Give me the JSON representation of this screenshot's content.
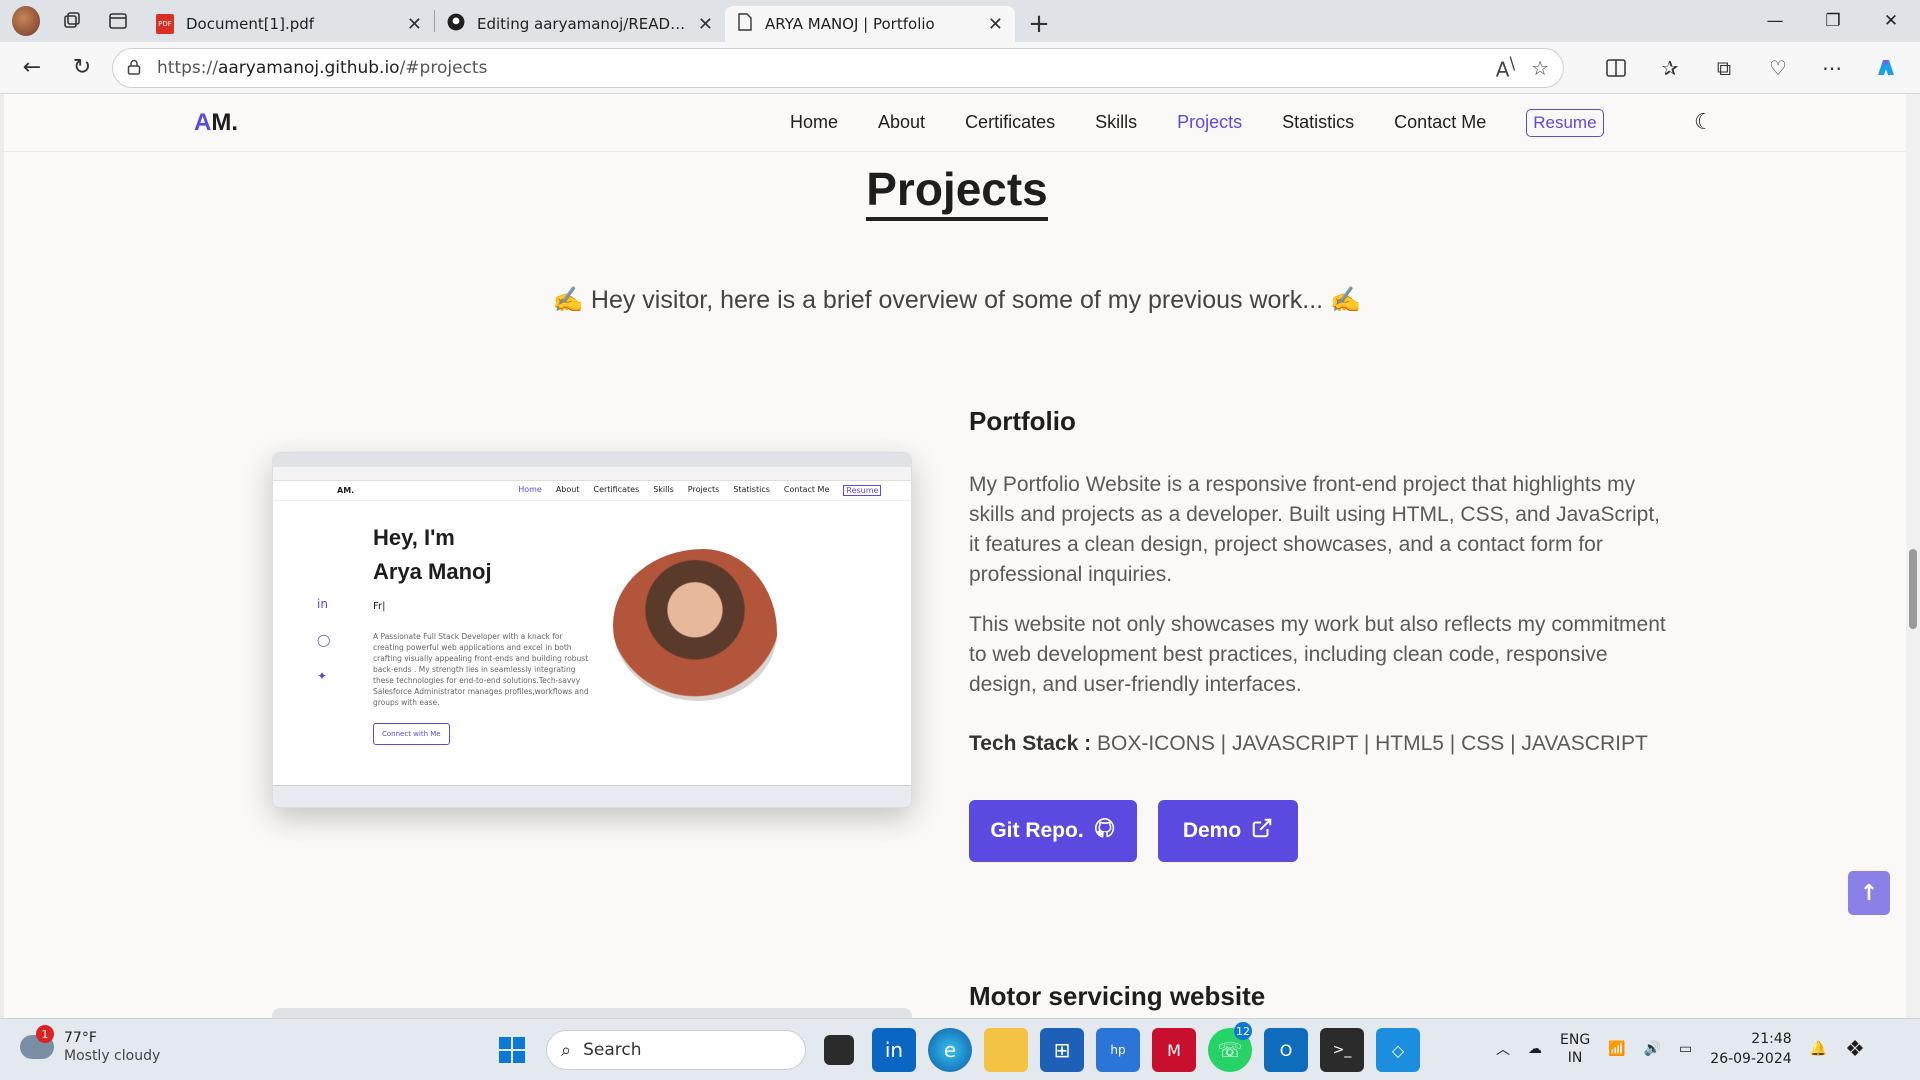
{
  "browser": {
    "tabs": [
      {
        "title": "Document[1].pdf",
        "icon": "pdf-icon"
      },
      {
        "title": "Editing aaryamanoj/README.md at",
        "icon": "github-icon"
      },
      {
        "title": "ARYA MANOJ | Portfolio",
        "icon": "page-icon",
        "active": true
      }
    ],
    "url_prefix": "https://",
    "url_host": "aaryamanoj.github.io",
    "url_path": "/#projects"
  },
  "site": {
    "logo_a": "A",
    "logo_rest": "M.",
    "nav": [
      "Home",
      "About",
      "Certificates",
      "Skills",
      "Projects",
      "Statistics",
      "Contact Me"
    ],
    "active_nav": "Projects",
    "resume": "Resume"
  },
  "projects_section": {
    "title": "Projects",
    "subtitle": "✍️ Hey visitor, here is a brief overview of some of my previous work... ✍️"
  },
  "project1": {
    "name": "Portfolio",
    "desc1": "My Portfolio Website is a responsive front-end project that highlights my skills and projects as a developer. Built using HTML, CSS, and JavaScript, it features a clean design, project showcases, and a contact form for professional inquiries.",
    "desc2": "This website not only showcases my work but also reflects my commitment to web development best practices, including clean code, responsive design, and user-friendly interfaces.",
    "tech_label": "Tech Stack :",
    "tech_value": "BOX-ICONS | JAVASCRIPT | HTML5 | CSS | JAVASCRIPT",
    "git_btn": "Git Repo.",
    "demo_btn": "Demo",
    "preview": {
      "hey": "Hey, I'm",
      "name": "Arya Manoj",
      "typed": "Fr|",
      "desc": "A Passionate Full Stack Developer with a knack for creating powerful web applications and excel in both crafting visually appealing front-ends and building robust back-ends . My strength lies in seamlessly integrating these technologies for end-to-end solutions.Tech-savvy Salesforce Administrator manages profiles,workflows and groups with ease.",
      "cta": "Connect with Me",
      "nav": [
        "Home",
        "About",
        "Certificates",
        "Skills",
        "Projects",
        "Statistics",
        "Contact Me",
        "Resume"
      ],
      "logo": "AM."
    }
  },
  "project2": {
    "name": "Motor servicing website"
  },
  "taskbar": {
    "temp": "77°F",
    "weather": "Mostly cloudy",
    "weather_badge": "1",
    "search": "Search",
    "whatsapp_badge": "12",
    "lang1": "ENG",
    "lang2": "IN",
    "time": "21:48",
    "date": "26-09-2024"
  }
}
